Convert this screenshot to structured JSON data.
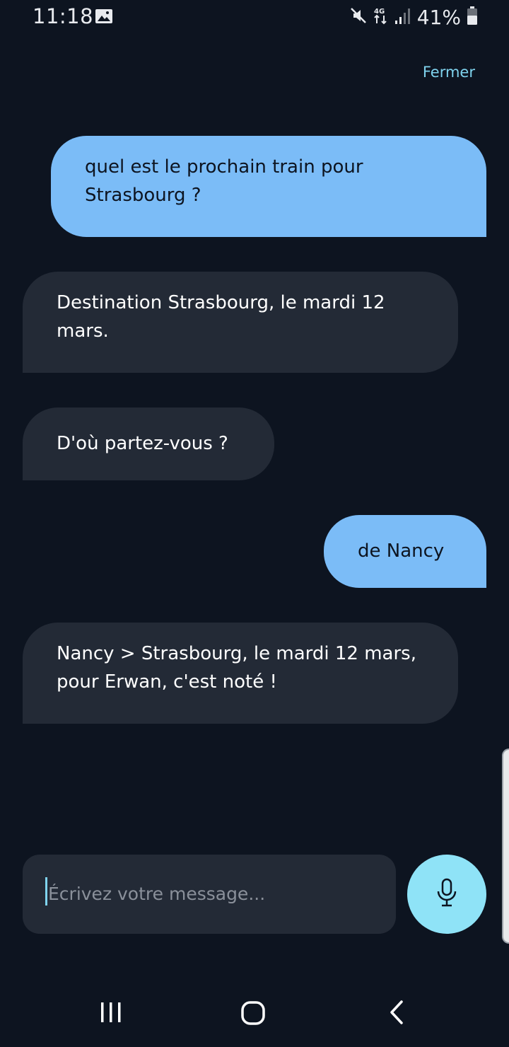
{
  "status_bar": {
    "time": "11:18",
    "battery": "41%",
    "icons": [
      "image-icon",
      "mute-icon",
      "4g-icon",
      "signal-icon",
      "battery-icon"
    ],
    "network": "4G"
  },
  "header": {
    "close_label": "Fermer"
  },
  "messages": [
    {
      "sender": "user",
      "text": "quel est le prochain train pour Strasbourg ?"
    },
    {
      "sender": "bot",
      "text": "Destination Strasbourg, le mardi 12 mars."
    },
    {
      "sender": "bot",
      "text": "D'où partez-vous ?"
    },
    {
      "sender": "user",
      "text": "de Nancy"
    },
    {
      "sender": "bot",
      "text": "Nancy > Strasbourg, le mardi 12 mars, pour Erwan, c'est noté !"
    }
  ],
  "composer": {
    "placeholder": "Écrivez votre message...",
    "value": "",
    "mic_icon": "microphone-icon"
  },
  "colors": {
    "background": "#0d1420",
    "user_bubble": "#7bbcf7",
    "bot_bubble": "#232a36",
    "accent": "#7fd3ee",
    "mic_button": "#8fe3f7"
  },
  "nav_bar": {
    "icons": [
      "recent-apps-icon",
      "home-icon",
      "back-icon"
    ]
  }
}
